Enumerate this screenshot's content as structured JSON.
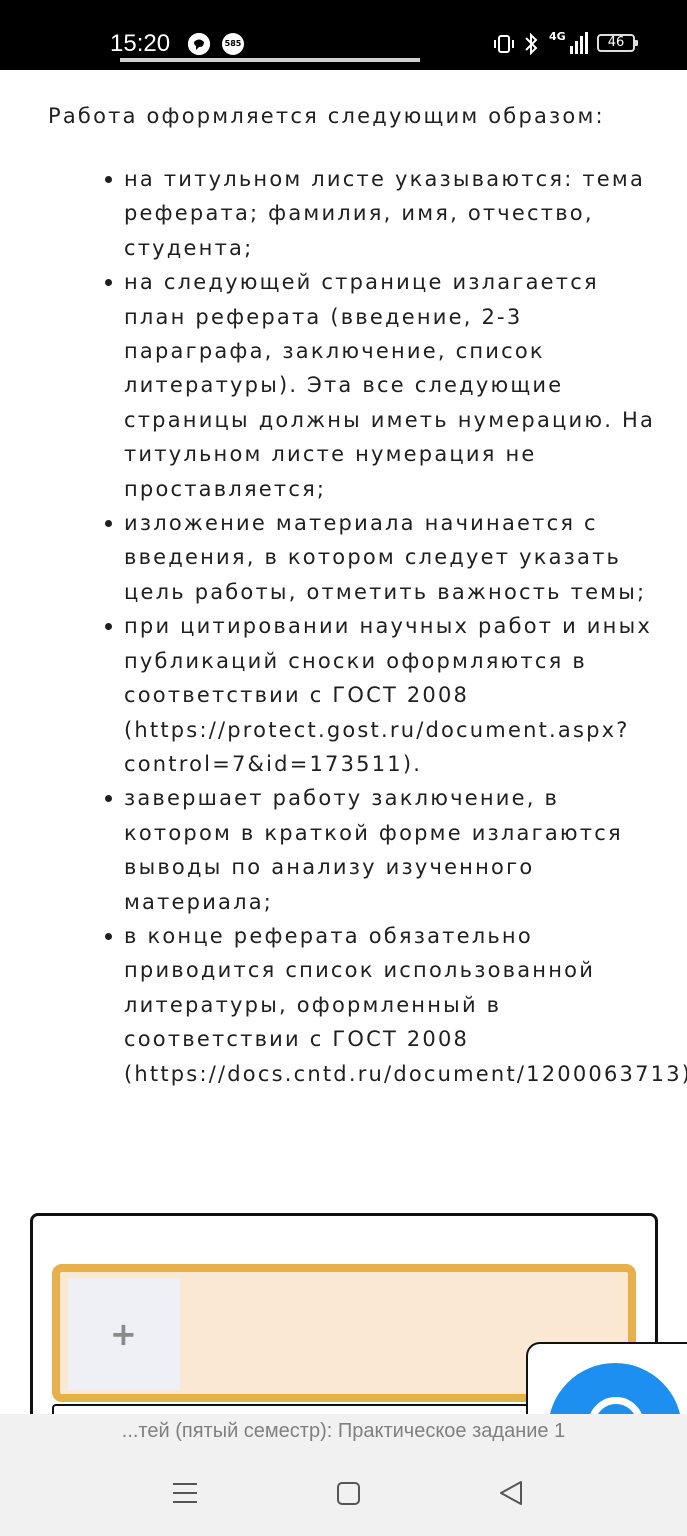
{
  "status_bar": {
    "time": "15:20",
    "notif_badge": "585",
    "network": "4G",
    "battery": "46"
  },
  "content": {
    "intro": "Работа оформляется следующим образом:",
    "bullets": [
      "на титульном листе указываются: тема\nреферата; фамилия, имя, отчество,\nстудента;",
      "на следующей странице излагается\nплан реферата (введение, 2-3\nпараграфа, заключение, список\nлитературы). Эта все следующие\nстраницы должны иметь нумерацию. На\nтитульном листе нумерация не\nпроставляется;",
      "изложение материала начинается с\nвведения, в котором следует указать\nцель работы, отметить важность темы;",
      "при цитировании научных работ и иных\nпубликаций сноски оформляются в\nсоответствии с ГОСТ 2008\n(https://protect.gost.ru/document.aspx?\ncontrol=7&id=173511).",
      "завершает работу заключение, в\nкотором в краткой форме излагаются\nвыводы по анализу изученного\nматериала;",
      "в конце реферата обязательно\nприводится список использованной\nлитературы, оформленный в\nсоответствии с ГОСТ 2008\n(https://docs.cntd.ru/document/1200063713)"
    ]
  },
  "upload": {
    "add_symbol": "+"
  },
  "browser": {
    "page_title": "...тей (пятый семестр): Практическое задание 1"
  },
  "colors": {
    "upload_border": "#e8b04b",
    "upload_fill": "#fbe8d2",
    "chat_button": "#1d8ff0"
  }
}
